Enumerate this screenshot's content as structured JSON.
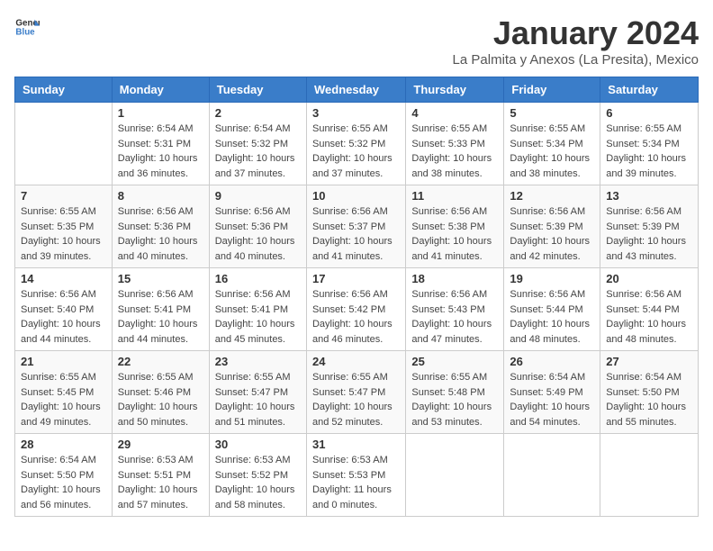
{
  "header": {
    "logo_general": "General",
    "logo_blue": "Blue",
    "month_title": "January 2024",
    "location": "La Palmita y Anexos (La Presita), Mexico"
  },
  "days_of_week": [
    "Sunday",
    "Monday",
    "Tuesday",
    "Wednesday",
    "Thursday",
    "Friday",
    "Saturday"
  ],
  "weeks": [
    [
      {
        "day": "",
        "info": ""
      },
      {
        "day": "1",
        "info": "Sunrise: 6:54 AM\nSunset: 5:31 PM\nDaylight: 10 hours\nand 36 minutes."
      },
      {
        "day": "2",
        "info": "Sunrise: 6:54 AM\nSunset: 5:32 PM\nDaylight: 10 hours\nand 37 minutes."
      },
      {
        "day": "3",
        "info": "Sunrise: 6:55 AM\nSunset: 5:32 PM\nDaylight: 10 hours\nand 37 minutes."
      },
      {
        "day": "4",
        "info": "Sunrise: 6:55 AM\nSunset: 5:33 PM\nDaylight: 10 hours\nand 38 minutes."
      },
      {
        "day": "5",
        "info": "Sunrise: 6:55 AM\nSunset: 5:34 PM\nDaylight: 10 hours\nand 38 minutes."
      },
      {
        "day": "6",
        "info": "Sunrise: 6:55 AM\nSunset: 5:34 PM\nDaylight: 10 hours\nand 39 minutes."
      }
    ],
    [
      {
        "day": "7",
        "info": "Sunrise: 6:55 AM\nSunset: 5:35 PM\nDaylight: 10 hours\nand 39 minutes."
      },
      {
        "day": "8",
        "info": "Sunrise: 6:56 AM\nSunset: 5:36 PM\nDaylight: 10 hours\nand 40 minutes."
      },
      {
        "day": "9",
        "info": "Sunrise: 6:56 AM\nSunset: 5:36 PM\nDaylight: 10 hours\nand 40 minutes."
      },
      {
        "day": "10",
        "info": "Sunrise: 6:56 AM\nSunset: 5:37 PM\nDaylight: 10 hours\nand 41 minutes."
      },
      {
        "day": "11",
        "info": "Sunrise: 6:56 AM\nSunset: 5:38 PM\nDaylight: 10 hours\nand 41 minutes."
      },
      {
        "day": "12",
        "info": "Sunrise: 6:56 AM\nSunset: 5:39 PM\nDaylight: 10 hours\nand 42 minutes."
      },
      {
        "day": "13",
        "info": "Sunrise: 6:56 AM\nSunset: 5:39 PM\nDaylight: 10 hours\nand 43 minutes."
      }
    ],
    [
      {
        "day": "14",
        "info": "Sunrise: 6:56 AM\nSunset: 5:40 PM\nDaylight: 10 hours\nand 44 minutes."
      },
      {
        "day": "15",
        "info": "Sunrise: 6:56 AM\nSunset: 5:41 PM\nDaylight: 10 hours\nand 44 minutes."
      },
      {
        "day": "16",
        "info": "Sunrise: 6:56 AM\nSunset: 5:41 PM\nDaylight: 10 hours\nand 45 minutes."
      },
      {
        "day": "17",
        "info": "Sunrise: 6:56 AM\nSunset: 5:42 PM\nDaylight: 10 hours\nand 46 minutes."
      },
      {
        "day": "18",
        "info": "Sunrise: 6:56 AM\nSunset: 5:43 PM\nDaylight: 10 hours\nand 47 minutes."
      },
      {
        "day": "19",
        "info": "Sunrise: 6:56 AM\nSunset: 5:44 PM\nDaylight: 10 hours\nand 48 minutes."
      },
      {
        "day": "20",
        "info": "Sunrise: 6:56 AM\nSunset: 5:44 PM\nDaylight: 10 hours\nand 48 minutes."
      }
    ],
    [
      {
        "day": "21",
        "info": "Sunrise: 6:55 AM\nSunset: 5:45 PM\nDaylight: 10 hours\nand 49 minutes."
      },
      {
        "day": "22",
        "info": "Sunrise: 6:55 AM\nSunset: 5:46 PM\nDaylight: 10 hours\nand 50 minutes."
      },
      {
        "day": "23",
        "info": "Sunrise: 6:55 AM\nSunset: 5:47 PM\nDaylight: 10 hours\nand 51 minutes."
      },
      {
        "day": "24",
        "info": "Sunrise: 6:55 AM\nSunset: 5:47 PM\nDaylight: 10 hours\nand 52 minutes."
      },
      {
        "day": "25",
        "info": "Sunrise: 6:55 AM\nSunset: 5:48 PM\nDaylight: 10 hours\nand 53 minutes."
      },
      {
        "day": "26",
        "info": "Sunrise: 6:54 AM\nSunset: 5:49 PM\nDaylight: 10 hours\nand 54 minutes."
      },
      {
        "day": "27",
        "info": "Sunrise: 6:54 AM\nSunset: 5:50 PM\nDaylight: 10 hours\nand 55 minutes."
      }
    ],
    [
      {
        "day": "28",
        "info": "Sunrise: 6:54 AM\nSunset: 5:50 PM\nDaylight: 10 hours\nand 56 minutes."
      },
      {
        "day": "29",
        "info": "Sunrise: 6:53 AM\nSunset: 5:51 PM\nDaylight: 10 hours\nand 57 minutes."
      },
      {
        "day": "30",
        "info": "Sunrise: 6:53 AM\nSunset: 5:52 PM\nDaylight: 10 hours\nand 58 minutes."
      },
      {
        "day": "31",
        "info": "Sunrise: 6:53 AM\nSunset: 5:53 PM\nDaylight: 11 hours\nand 0 minutes."
      },
      {
        "day": "",
        "info": ""
      },
      {
        "day": "",
        "info": ""
      },
      {
        "day": "",
        "info": ""
      }
    ]
  ]
}
